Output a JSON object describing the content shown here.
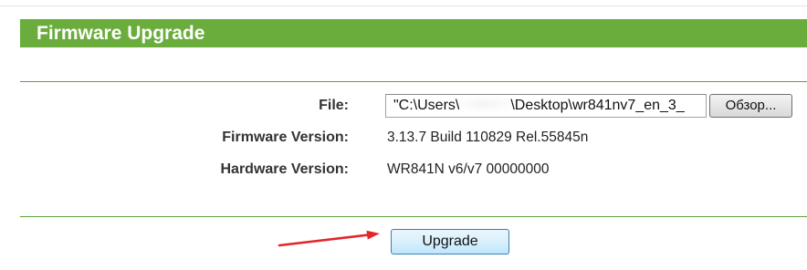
{
  "page": {
    "title": "Firmware Upgrade"
  },
  "form": {
    "file": {
      "label": "File:",
      "value_prefix": "\"C:\\Users\\",
      "value_suffix": "\\Desktop\\wr841nv7_en_3_",
      "browse_label": "Обзор..."
    },
    "firmware": {
      "label": "Firmware Version:",
      "value": "3.13.7 Build 110829 Rel.55845n"
    },
    "hardware": {
      "label": "Hardware Version:",
      "value": "WR841N v6/v7 00000000"
    },
    "upgrade_label": "Upgrade"
  },
  "icons": {
    "annotation": "red-arrow-icon"
  },
  "colors": {
    "header": "#6aad3c",
    "rule": "#5f9f3a",
    "arrow": "#e3262b"
  }
}
